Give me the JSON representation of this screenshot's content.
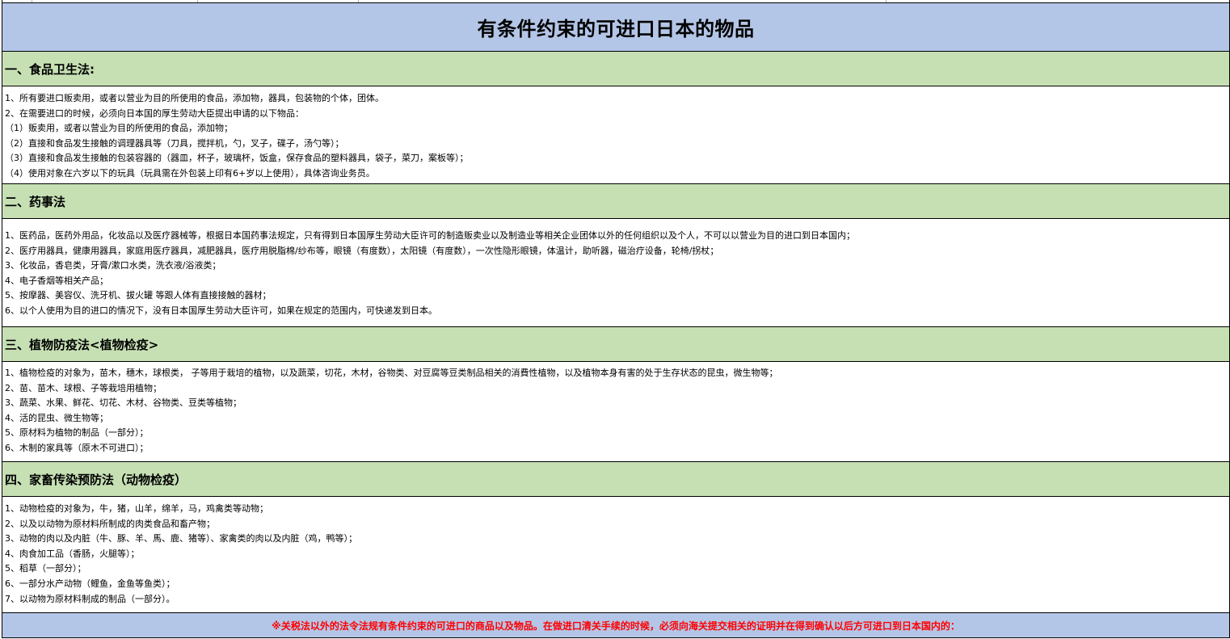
{
  "title": "有条件约束的可进口日本的物品",
  "sections": [
    {
      "header": "一、食品卫生法:",
      "lines": [
        "1、所有要进口贩卖用，或者以营业为目的所使用的食品，添加物，器具，包装物的个体，团体。",
        "2、在需要进口的时候，必须向日本国的厚生劳动大臣提出申请的以下物品：",
        "（1）贩卖用，或者以营业为目的所使用的食品，添加物；",
        "（2）直接和食品发生接触的调理器具等（刀具，搅拌机，勺，叉子，碟子，汤勺等）；",
        "（3）直接和食品发生接触的包装容器的（器皿，杯子，玻璃杯，饭盒，保存食品的塑料器具，袋子，菜刀，案板等）；",
        "（4）使用对象在六岁以下的玩具（玩具需在外包装上印有6+岁以上使用），具体咨询业务员。"
      ]
    },
    {
      "header": "二、药事法",
      "lines": [
        "1、医药品，医药外用品，化妆品以及医疗器械等，根据日本国药事法规定，只有得到日本国厚生劳动大臣许可的制造贩卖业以及制造业等相关企业团体以外的任何组织以及个人，不可以以营业为目的进口到日本国内；",
        "2、医疗用器具，健康用器具，家庭用医疗器具，减肥器具，医疗用脱脂棉/纱布等，眼镜（有度数），太阳镜（有度数），一次性隐形眼镜，体温计，助听器，磁治疗设备，轮椅/拐杖；",
        "3、化妆品，香皂类，牙膏/漱口水类，洗衣液/浴液类；",
        "4、电子香烟等相关产品；",
        "5、按摩器、美容仪、洗牙机、拔火罐 等跟人体有直接接触的器材；",
        "6、以个人使用为目的进口的情况下，没有日本国厚生劳动大臣许可，如果在规定的范围内，可快递发到日本。"
      ]
    },
    {
      "header": "三、植物防疫法<植物检疫>",
      "lines": [
        "1、植物检疫的对象为，苗木，穗木，球根类， 子等用于栽培的植物，以及蔬菜，切花，木材，谷物类、对豆腐等豆类制品相关的消費性植物，以及植物本身有害的处于生存状态的昆虫，微生物等；",
        "2、苗、苗木、球根、子等栽培用植物；",
        "3、蔬菜、水果、鲜花、切花、木材、谷物类、豆类等植物；",
        "4、活的昆虫、微生物等；",
        "5、原材料为植物的制品（一部分）；",
        "6、木制的家具等（原木不可进口）；"
      ]
    },
    {
      "header": "四、家畜传染预防法（动物检疫）",
      "lines": [
        "1、动物检疫的对象为，牛，猪，山羊，绵羊，马，鸡禽类等动物；",
        "2、以及以动物为原材料所制成的肉类食品和畜产物；",
        "3、动物的肉以及内脏（牛、豚、羊、馬、鹿、猪等）、家禽类的肉以及内脏（鸡，鸭等）；",
        "4、肉食加工品（香肠，火腿等）；",
        "5、稻草（一部分）；",
        "6、一部分水产动物（鲤鱼，金鱼等鱼类）；",
        "7、以动物为原材料制成的制品（一部分）。"
      ]
    }
  ],
  "footer": "※关税法以外的法令法规有条件约束的可进口的商品以及物品。在做进口清关手续的时候，必须向海关提交相关的证明并在得到确认以后方可进口到日本国内的："
}
